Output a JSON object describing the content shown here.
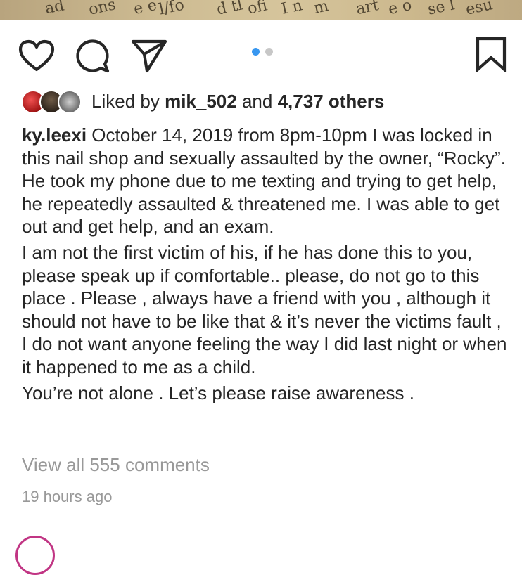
{
  "post_image": {
    "visible_fragments": [
      "ad",
      "ons",
      "e e",
      "l/fo",
      "d tl",
      "ofi",
      "I n",
      "m",
      "art",
      "e o",
      "se l",
      "esu"
    ]
  },
  "actions": {
    "like_icon": "heart-icon",
    "comment_icon": "comment-bubble-icon",
    "share_icon": "paper-plane-icon",
    "save_icon": "bookmark-icon",
    "carousel": {
      "total": 2,
      "current": 1
    },
    "colors": {
      "active_dot": "#3897f0",
      "inactive_dot": "#c7c7c7"
    }
  },
  "likes": {
    "prefix": "Liked by",
    "user": "mik_502",
    "conjunction": "and",
    "others": "4,737 others"
  },
  "caption": {
    "username": "ky.leexi",
    "paragraphs": [
      "October 14, 2019 from 8pm-10pm I was locked in this nail shop and sexually assaulted by the owner, “Rocky”. He took my phone due to me texting and trying to get help, he repeatedly assaulted & threatened me. I was able to get out and get help, and an exam.",
      "I am not the first victim of his, if he has done this to you, please speak up if comfortable.. please, do not go to this place . Please , always have a friend with you , although it should not have to be like that & it’s never the victims fault , I do not want anyone feeling the way I did last night or when it happened to me as a child.",
      "You’re not alone . Let’s please raise awareness ."
    ]
  },
  "comments_link": "View all 555 comments",
  "timestamp": "19 hours ago"
}
